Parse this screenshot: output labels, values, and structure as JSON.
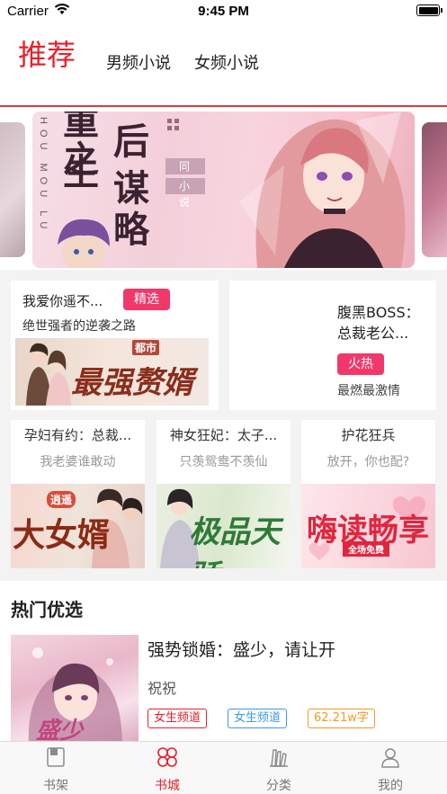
{
  "status_bar": {
    "carrier": "Carrier",
    "time": "9:45 PM"
  },
  "header": {
    "tabs": [
      {
        "label": "推荐",
        "active": true
      },
      {
        "label": "男频小说",
        "active": false
      },
      {
        "label": "女频小说",
        "active": false
      }
    ],
    "accent_color": "#e8202a"
  },
  "banner": {
    "vertical_text": "HOU MOU LU",
    "title_chars": [
      "重",
      "生",
      "之",
      "后",
      "谋",
      "略"
    ],
    "badge_lines": [
      "同名",
      "小说"
    ]
  },
  "featured": [
    {
      "title": "我爱你遥不...",
      "tag": "精选",
      "subtitle": "绝世强者的逆袭之路",
      "cover_text": "最强赘婿",
      "cover_tag": "都市"
    },
    {
      "title_lines": [
        "腹黑BOSS：",
        "总裁老公..."
      ],
      "tag": "火热",
      "subtitle": "最燃最激情"
    }
  ],
  "small_cards": [
    {
      "title": "孕妇有约：总裁...",
      "subtitle": "我老婆谁敢动",
      "cover_text": "大女婿",
      "cover_tag": "逍遥"
    },
    {
      "title": "神女狂妃：太子...",
      "subtitle": "只羡鸳鸯不羡仙",
      "cover_text": "极品天骄"
    },
    {
      "title": "护花狂兵",
      "subtitle": "放开，你也配?",
      "cover_text": "嗨读畅享",
      "cover_tag": "全场免费"
    }
  ],
  "hot": {
    "section_title": "热门优选",
    "book": {
      "title": "强势锁婚：盛少，请让开",
      "author": "祝祝",
      "cover_text": "盛少",
      "tags": [
        {
          "label": "女生频道",
          "color": "#e8202a"
        },
        {
          "label": "女生频道",
          "color": "#3a9be8"
        },
        {
          "label": "62.21w字",
          "color": "#f09a22"
        }
      ]
    }
  },
  "tabbar": {
    "items": [
      {
        "label": "书架",
        "icon": "bookshelf-icon",
        "active": false
      },
      {
        "label": "书城",
        "icon": "clover-icon",
        "active": true
      },
      {
        "label": "分类",
        "icon": "books-icon",
        "active": false
      },
      {
        "label": "我的",
        "icon": "person-icon",
        "active": false
      }
    ]
  }
}
